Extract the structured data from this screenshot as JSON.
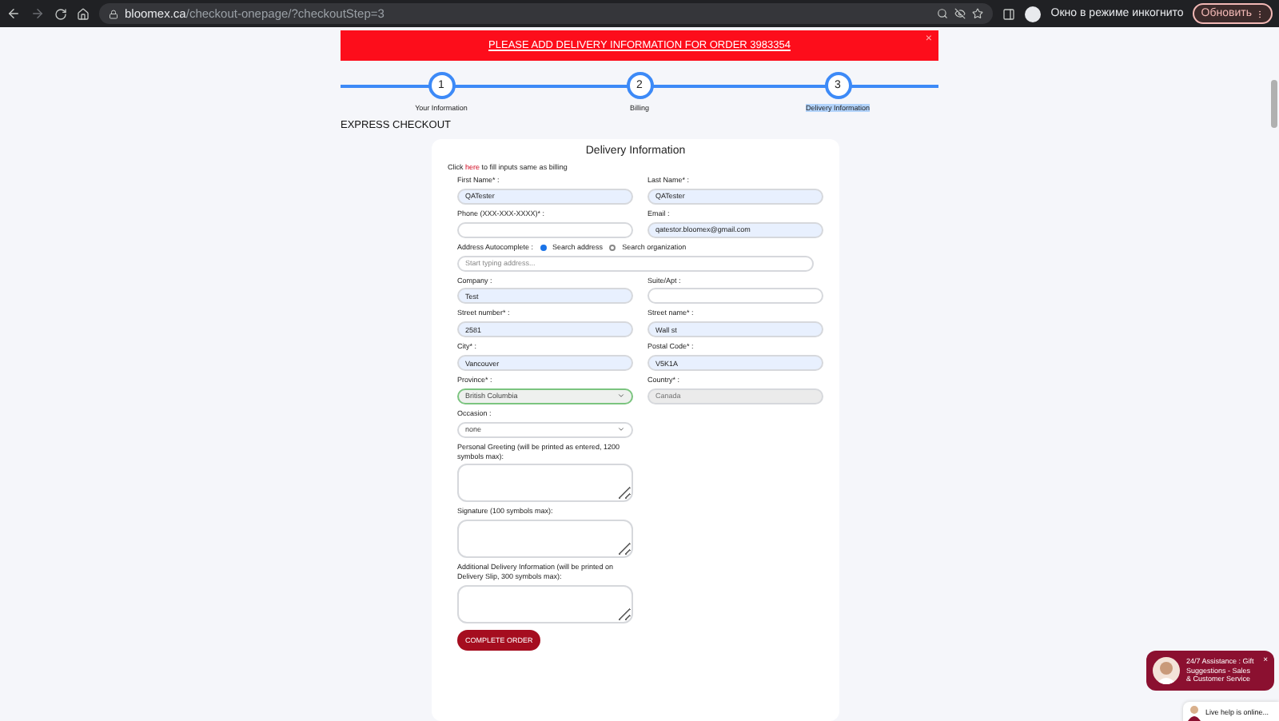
{
  "browser": {
    "url_host": "bloomex.ca",
    "url_path": "/checkout-onepage/?checkoutStep=3",
    "profile_label": "Окно в режиме инкогнито",
    "update_button": "Обновить"
  },
  "banner": {
    "text": "PLEASE ADD DELIVERY INFORMATION FOR ORDER 3983354",
    "close": "×"
  },
  "steps": [
    {
      "number": "1",
      "label": "Your Information",
      "selected": false
    },
    {
      "number": "2",
      "label": "Billing",
      "selected": false
    },
    {
      "number": "3",
      "label": "Delivery Information",
      "selected": true
    }
  ],
  "heading": "EXPRESS CHECKOUT",
  "form": {
    "title": "Delivery Information",
    "prefill": {
      "before": "Click",
      "link": "here",
      "after": "to fill inputs same as billing"
    },
    "rows": [
      [
        {
          "kind": "input",
          "label": "First Name* :",
          "value": "QATester",
          "autofilled": true
        },
        {
          "kind": "input",
          "label": "Last Name* :",
          "value": "QATester",
          "autofilled": true
        }
      ],
      [
        {
          "kind": "input",
          "label": "Phone (XXX-XXX-XXXX)* :",
          "autofilled": false
        },
        {
          "kind": "input",
          "label": "Email :",
          "value": "qatestor.bloomex@gmail.com",
          "autofilled": true
        }
      ],
      [
        {
          "kind": "address",
          "label": "Address Autocomplete :",
          "placeholder": "Start typing address...",
          "options": [
            {
              "label": "Search address",
              "selected": true
            },
            {
              "label": "Search organization",
              "selected": false
            }
          ]
        }
      ],
      [
        {
          "kind": "input",
          "label": "Company :",
          "value": "Test",
          "autofilled": true
        },
        {
          "kind": "input",
          "label": "Suite/Apt :",
          "autofilled": false
        }
      ],
      [
        {
          "kind": "input",
          "label": "Street number* :",
          "value": "2581",
          "autofilled": true
        },
        {
          "kind": "input",
          "label": "Street name* :",
          "value": "Wall st",
          "autofilled": true
        }
      ],
      [
        {
          "kind": "input",
          "label": "City* :",
          "value": "Vancouver",
          "autofilled": true
        },
        {
          "kind": "input",
          "label": "Postal Code* :",
          "value": "V5K1A",
          "autofilled": true
        }
      ],
      [
        {
          "kind": "select",
          "label": "Province* :",
          "value": "British Columbia",
          "valid": true
        },
        {
          "kind": "input",
          "label": "Country* :",
          "value": "Canada",
          "disabled": true
        }
      ],
      [
        {
          "kind": "select",
          "label": "Occasion :",
          "value": "none",
          "valid": false
        }
      ],
      [
        {
          "kind": "textarea",
          "label": "Personal Greeting (will be printed as entered, 1200 symbols max):"
        }
      ],
      [
        {
          "kind": "textarea",
          "label": "Signature (100 symbols max):"
        }
      ],
      [
        {
          "kind": "textarea",
          "label": "Additional Delivery Information (will be printed on Delivery Slip, 300 symbols max):"
        }
      ]
    ],
    "submit": "COMPLETE ORDER"
  },
  "chat": {
    "text": "24/7 Assistance : Gift Suggestions - Sales & Customer Service",
    "close": "×",
    "live": "Live help is online..."
  }
}
